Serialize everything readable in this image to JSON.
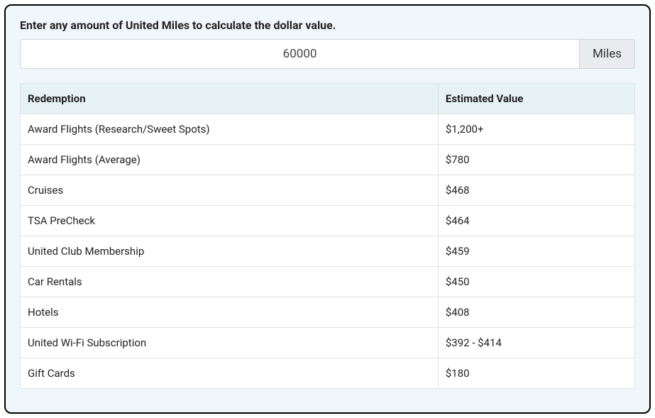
{
  "prompt": "Enter any amount of United Miles to calculate the dollar value.",
  "input": {
    "value": "60000",
    "addon": "Miles"
  },
  "table": {
    "headers": {
      "redemption": "Redemption",
      "value": "Estimated Value"
    },
    "rows": [
      {
        "redemption": "Award Flights (Research/Sweet Spots)",
        "value": "$1,200+"
      },
      {
        "redemption": "Award Flights (Average)",
        "value": "$780"
      },
      {
        "redemption": "Cruises",
        "value": "$468"
      },
      {
        "redemption": "TSA PreCheck",
        "value": "$464"
      },
      {
        "redemption": "United Club Membership",
        "value": "$459"
      },
      {
        "redemption": "Car Rentals",
        "value": "$450"
      },
      {
        "redemption": "Hotels",
        "value": "$408"
      },
      {
        "redemption": "United Wi-Fi Subscription",
        "value": "$392 - $414"
      },
      {
        "redemption": "Gift Cards",
        "value": "$180"
      }
    ]
  }
}
